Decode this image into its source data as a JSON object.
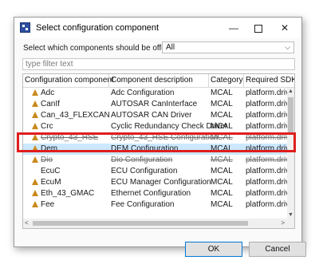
{
  "window": {
    "title": "Select configuration component"
  },
  "offer": {
    "label": "Select which components should be offered",
    "selected": "All"
  },
  "filter": {
    "placeholder": "type filter text"
  },
  "table": {
    "columns": [
      "Configuration component",
      "Component description",
      "Category",
      "Required SDK"
    ],
    "rows": [
      {
        "name": "Adc",
        "desc": "Adc Configuration",
        "category": "MCAL",
        "sdk": "platform.drive",
        "icon": true,
        "strike": false
      },
      {
        "name": "CanIf",
        "desc": "AUTOSAR CanInterface",
        "category": "MCAL",
        "sdk": "platform.drive",
        "icon": true,
        "strike": false
      },
      {
        "name": "Can_43_FLEXCAN",
        "desc": "AUTOSAR CAN Driver",
        "category": "MCAL",
        "sdk": "platform.drive",
        "icon": true,
        "strike": false
      },
      {
        "name": "Crc",
        "desc": "Cyclic Redundancy Check Driver",
        "category": "MCAL",
        "sdk": "platform.drive",
        "icon": true,
        "strike": false
      },
      {
        "name": "Crypto_43_HSE",
        "desc": "Crypto_43_HSE Configuration",
        "category": "MCAL",
        "sdk": "platform.drive",
        "icon": true,
        "strike": true
      },
      {
        "name": "Dem",
        "desc": "DEM Configuration",
        "category": "MCAL",
        "sdk": "platform.drive",
        "icon": true,
        "strike": false
      },
      {
        "name": "Dio",
        "desc": "Dio Configuration",
        "category": "MCAL",
        "sdk": "platform.drive",
        "icon": true,
        "strike": true
      },
      {
        "name": "EcuC",
        "desc": "ECU Configuration",
        "category": "MCAL",
        "sdk": "platform.drive",
        "icon": false,
        "strike": false
      },
      {
        "name": "EcuM",
        "desc": "ECU Manager Configuration",
        "category": "MCAL",
        "sdk": "platform.drive",
        "icon": true,
        "strike": false
      },
      {
        "name": "Eth_43_GMAC",
        "desc": "Ethernet Configuration",
        "category": "MCAL",
        "sdk": "platform.drive",
        "icon": true,
        "strike": false
      },
      {
        "name": "Fee",
        "desc": "Fee Configuration",
        "category": "MCAL",
        "sdk": "platform.drive",
        "icon": true,
        "strike": false
      }
    ],
    "selected_index": 5
  },
  "buttons": {
    "ok": "OK",
    "cancel": "Cancel"
  },
  "colors": {
    "selection": "#cce8ff",
    "highlight": "#e01e1e",
    "row_icon": "#c98a1b"
  }
}
